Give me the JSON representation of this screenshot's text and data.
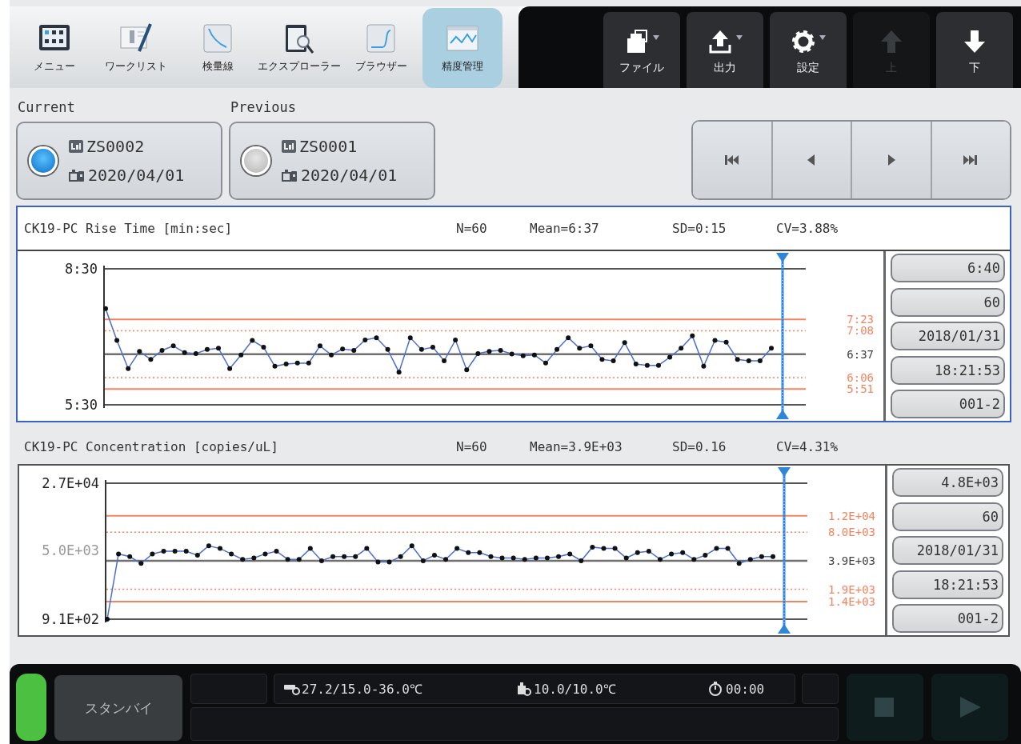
{
  "toolbar": {
    "left": [
      {
        "kind": "menu",
        "label": "メニュー",
        "selected": false
      },
      {
        "kind": "worklist",
        "label": "ワークリスト",
        "selected": false
      },
      {
        "kind": "calibration",
        "label": "検量線",
        "selected": false
      },
      {
        "kind": "explorer",
        "label": "エクスプローラー",
        "selected": false
      },
      {
        "kind": "browser",
        "label": "ブラウザー",
        "selected": false
      },
      {
        "kind": "qc",
        "label": "精度管理",
        "selected": true
      }
    ],
    "right": [
      {
        "kind": "file",
        "label": "ファイル",
        "dropdown": true,
        "disabled": false
      },
      {
        "kind": "output",
        "label": "出力",
        "dropdown": true,
        "disabled": false
      },
      {
        "kind": "settings",
        "label": "設定",
        "dropdown": true,
        "disabled": false
      },
      {
        "kind": "up",
        "label": "上",
        "dropdown": false,
        "disabled": true
      },
      {
        "kind": "down",
        "label": "下",
        "dropdown": false,
        "disabled": false
      }
    ]
  },
  "lots": [
    {
      "heading": "Current",
      "lot": "ZS0002",
      "date": "2020/04/01",
      "selected": true
    },
    {
      "heading": "Previous",
      "lot": "ZS0001",
      "date": "2020/04/01",
      "selected": false
    }
  ],
  "navigation": [
    {
      "kind": "first"
    },
    {
      "kind": "previous"
    },
    {
      "kind": "next"
    },
    {
      "kind": "last"
    }
  ],
  "charts": [
    {
      "title": "CK19-PC Rise Time [min:sec]",
      "stats": [
        "N=60",
        "Mean=6:37",
        "SD=0:15",
        "CV=3.88%"
      ],
      "selected": true,
      "chart_data": {
        "type": "line",
        "ylim": [
          5.5,
          8.5
        ],
        "yticks": [
          {
            "value": 8.5,
            "label": "8:30"
          },
          {
            "value": 5.5,
            "label": "5:30"
          }
        ],
        "series": [
          {
            "color": "#4a6fd0",
            "marker": "o",
            "values": [
              7.62,
              6.92,
              6.3,
              6.68,
              6.5,
              6.7,
              6.8,
              6.65,
              6.63,
              6.72,
              6.75,
              6.3,
              6.6,
              6.92,
              6.77,
              6.35,
              6.4,
              6.42,
              6.42,
              6.8,
              6.6,
              6.73,
              6.7,
              6.93,
              6.98,
              6.72,
              6.22,
              6.98,
              6.72,
              6.77,
              6.47,
              6.93,
              6.27,
              6.63,
              6.68,
              6.7,
              6.62,
              6.58,
              6.6,
              6.42,
              6.72,
              6.98,
              6.75,
              6.8,
              6.5,
              6.47,
              6.87,
              6.4,
              6.37,
              6.37,
              6.55,
              6.75,
              7.02,
              6.35,
              6.92,
              6.88,
              6.5,
              6.47,
              6.47,
              6.75
            ]
          }
        ]
      },
      "limit_labels": [
        "7:23",
        "7:08",
        "6:37",
        "6:06",
        "5:51"
      ],
      "cursor_values": [
        "6:40",
        "60",
        "2018/01/31",
        "18:21:53",
        "001-2"
      ]
    },
    {
      "title": "CK19-PC Concentration [copies/uL]",
      "stats": [
        "N=60",
        "Mean=3.9E+03",
        "SD=0.16",
        "CV=4.31%"
      ],
      "selected": false,
      "axis_labels": [
        "2.7E+04",
        "5.0E+03",
        "9.1E+02"
      ],
      "limit_labels": [
        "1.2E+04",
        "8.0E+03",
        "3.9E+03",
        "1.9E+03",
        "1.4E+03"
      ],
      "cursor_values": [
        "4.8E+03",
        "60",
        "2018/01/31",
        "18:21:53",
        "001-2"
      ]
    }
  ],
  "status_bar": {
    "indicator": {
      "color": "#4cc040"
    },
    "state": "スタンバイ",
    "readings": [
      {
        "kind": "thermometer",
        "text": "27.2/15.0-36.0℃"
      },
      {
        "kind": "bottle",
        "text": "10.0/10.0℃"
      },
      {
        "kind": "timer",
        "text": "00:00"
      }
    ],
    "controls": [
      {
        "kind": "stop",
        "disabled": true
      },
      {
        "kind": "play",
        "disabled": true
      }
    ]
  }
}
